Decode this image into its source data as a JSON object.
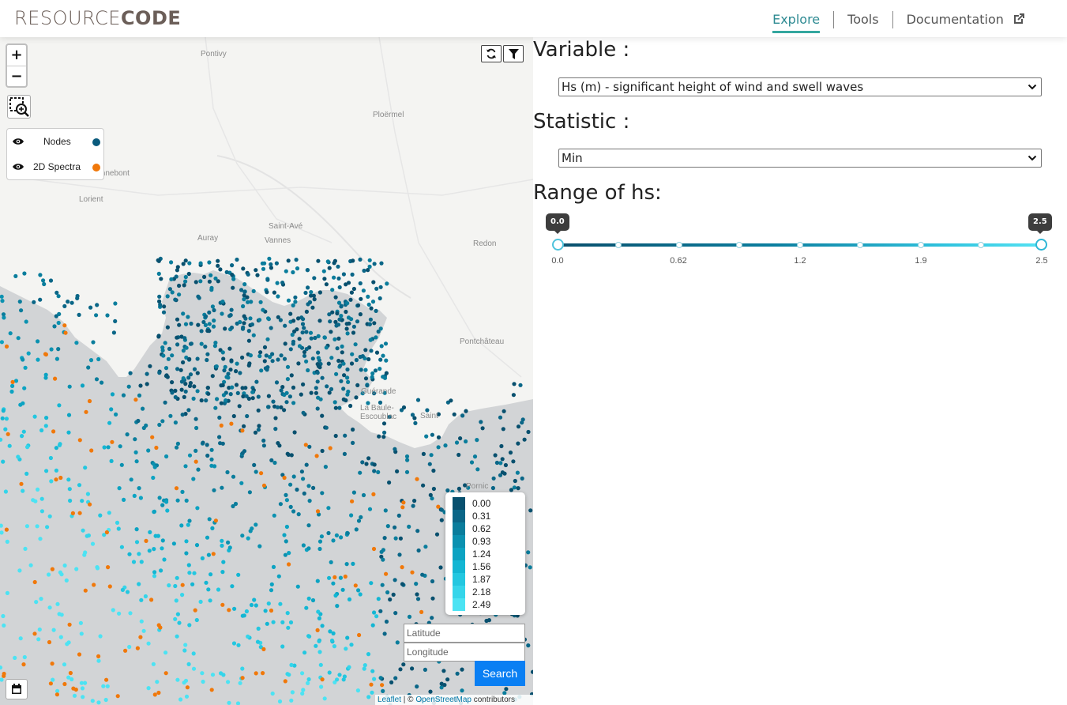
{
  "header": {
    "logo_light": "RESOURCE",
    "logo_bold": "CODE",
    "nav": [
      {
        "label": "Explore",
        "active": true
      },
      {
        "label": "Tools",
        "active": false
      },
      {
        "label": "Documentation",
        "active": false
      }
    ]
  },
  "map": {
    "zoom_in": "+",
    "zoom_out": "−",
    "layers": [
      {
        "label": "Nodes",
        "color": "#0a5a7c"
      },
      {
        "label": "2D Spectra",
        "color": "#f0780a"
      }
    ],
    "places": [
      "Pontivy",
      "Ploërmel",
      "Hennebont",
      "Lorient",
      "Auray",
      "Vannes",
      "Saint-Avé",
      "Redon",
      "Pontchâteau",
      "Guérande",
      "La Baule-Escoublac",
      "Saint",
      "Pornic"
    ],
    "legend": {
      "values": [
        "0.00",
        "0.31",
        "0.62",
        "0.93",
        "1.24",
        "1.56",
        "1.87",
        "2.18",
        "2.49"
      ],
      "colors": [
        "#08506e",
        "#0a6687",
        "#0a7d9c",
        "#0b91b0",
        "#0ca3c2",
        "#13b6d3",
        "#23c7e0",
        "#35d5ea",
        "#4ce3f3"
      ]
    },
    "latitude_placeholder": "Latitude",
    "longitude_placeholder": "Longitude",
    "search_label": "Search",
    "attribution": {
      "leaflet": "Leaflet",
      "sep": " | © ",
      "osm": "OpenStreetMap",
      "tail": " contributors"
    }
  },
  "panel": {
    "variable_heading": "Variable :",
    "variable_value": "Hs (m) - significant height of wind and swell waves",
    "statistic_heading": "Statistic :",
    "statistic_value": "Min",
    "range_heading": "Range of hs:",
    "slider": {
      "min_value": 0.0,
      "max_value": 2.5,
      "low_label": "0.0",
      "high_label": "2.5",
      "marks": [
        "0.0",
        "0.62",
        "1.2",
        "1.9",
        "2.5"
      ]
    }
  }
}
